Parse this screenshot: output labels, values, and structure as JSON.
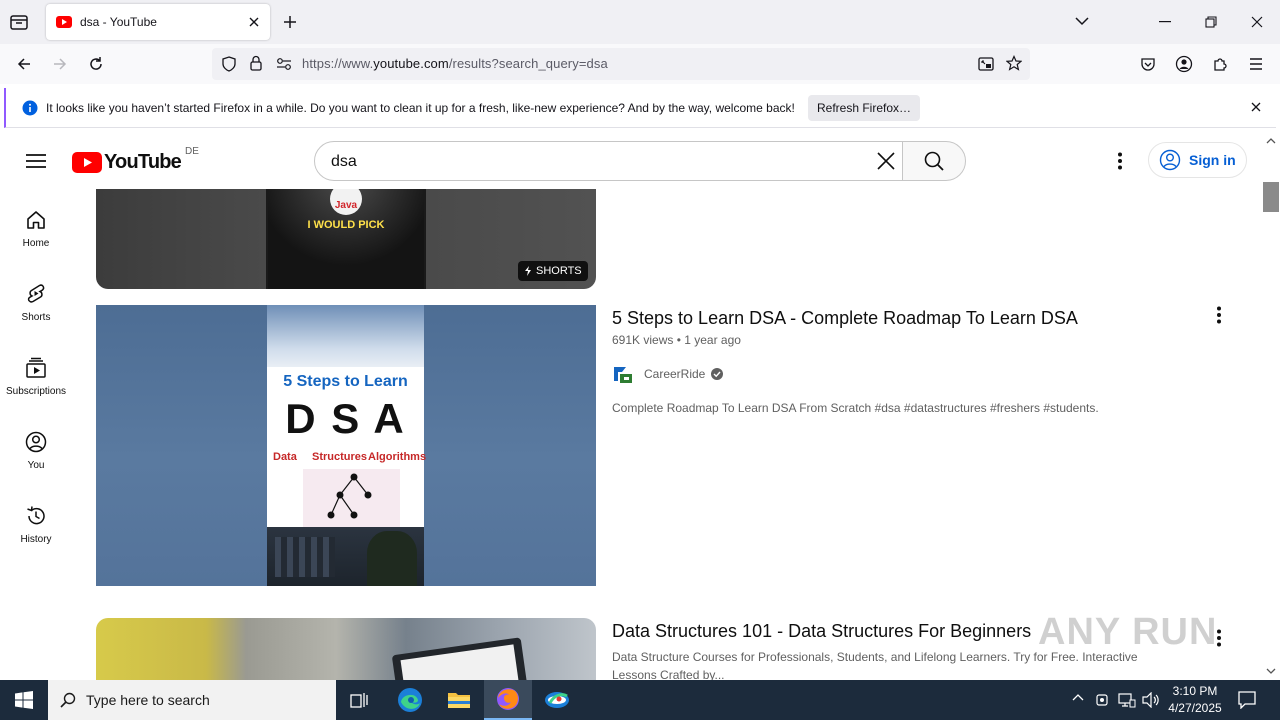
{
  "browser": {
    "tab": {
      "title": "dsa - YouTube"
    },
    "url": {
      "scheme": "https://www.",
      "domain": "youtube.com",
      "path": "/results?search_query=dsa"
    },
    "notification": {
      "message": "It looks like you haven’t started Firefox in a while. Do you want to clean it up for a fresh, like-new experience? And by the way, welcome back!",
      "button": "Refresh Firefox…"
    }
  },
  "youtube": {
    "logo_text": "YouTube",
    "region": "DE",
    "search_query": "dsa",
    "sign_in": "Sign in",
    "sidebar": [
      {
        "label": "Home",
        "icon": "home-icon"
      },
      {
        "label": "Shorts",
        "icon": "shorts-icon"
      },
      {
        "label": "Subscriptions",
        "icon": "subscriptions-icon"
      },
      {
        "label": "You",
        "icon": "you-icon"
      },
      {
        "label": "History",
        "icon": "history-icon"
      }
    ],
    "shorts_item": {
      "badge": "SHORTS",
      "thumb_text_top": "Java",
      "thumb_text": "I WOULD PICK"
    },
    "videos": [
      {
        "title": "5 Steps to Learn DSA - Complete Roadmap To Learn DSA",
        "meta": "691K views • 1 year ago",
        "channel": "CareerRide",
        "description": "Complete Roadmap To Learn DSA From Scratch #dsa #datastructures #freshers #students.",
        "thumb": {
          "heading": "5 Steps to Learn",
          "big": "D S A",
          "w1": "Data",
          "w2": "Structures",
          "w3": "Algorithms"
        }
      },
      {
        "title": "Data Structures 101 - Data Structures For Beginners",
        "description": "Data Structure Courses for Professionals, Students, and Lifelong Learners. Try for Free. Interactive Lessons Crafted by..."
      }
    ],
    "watermark": "ANY RUN"
  },
  "taskbar": {
    "search_placeholder": "Type here to search",
    "time": "3:10 PM",
    "date": "4/27/2025"
  },
  "colors": {
    "yt_red": "#ff0000",
    "link_blue": "#065fd4",
    "firefox_purple": "#9059ff",
    "taskbar": "#1c2b3c"
  }
}
